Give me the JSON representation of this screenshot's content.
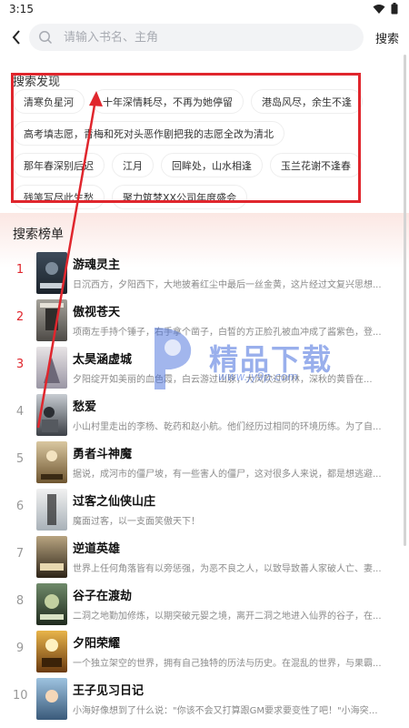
{
  "status": {
    "time": "3:15"
  },
  "search": {
    "placeholder": "请输入书名、主角",
    "button_label": "搜索"
  },
  "discover": {
    "title": "搜索发现",
    "tags": [
      "清寒负星河",
      "十年深情耗尽，不再为她停留",
      "港岛风尽，余生不逢",
      "高考填志愿，青梅和死对头恶作剧把我的志愿全改为清北",
      "那年春深别后迟",
      "江月",
      "回眸处，山水相逢",
      "玉兰花谢不逢春",
      "残笺写尽此生愁",
      "聚力筑梦XX公司年度盛会"
    ]
  },
  "ranking": {
    "title": "搜索榜单",
    "items": [
      {
        "rank": "1",
        "title": "游魂灵主",
        "desc": "日沉西方，夕阳西下，大地披着红尘中最后一丝金黄，这片经过文复兴思想...",
        "top": true
      },
      {
        "rank": "2",
        "title": "傲视苍天",
        "desc": "项南左手持个锤子，右手拿个凿子，白皙的方正脸孔被血冲成了酱紫色，登...",
        "top": true
      },
      {
        "rank": "3",
        "title": "太昊涵虚城",
        "desc": "夕阳绽开如美丽的血色霞，白云游过山脉，大风吹过树林，深秋的黄昏在...",
        "top": true
      },
      {
        "rank": "4",
        "title": "愁爱",
        "desc": "小山村里走出的李杨、乾药和赵小航。他们经历过相同的环境历练。为了自...",
        "top": false
      },
      {
        "rank": "5",
        "title": "勇者斗神魔",
        "desc": "据说，成河市的僵尸坡，有一些害人的僵尸，这对很多人来说，都是想逃避...",
        "top": false
      },
      {
        "rank": "6",
        "title": "过客之仙侠山庄",
        "desc": "魔面过客，以一支面笑傲天下！",
        "top": false
      },
      {
        "rank": "7",
        "title": "逆道英雄",
        "desc": "世界上任何角落皆有以旁惩强，为恶不良之人，以致导致善人家破人亡、妻...",
        "top": false
      },
      {
        "rank": "8",
        "title": "谷子在渡劫",
        "desc": "二洞之地勤加修炼，以期突破元婴之境，离开二洞之地进入仙界的谷子，在...",
        "top": false
      },
      {
        "rank": "9",
        "title": "夕阳荣耀",
        "desc": "一个独立架空的世界，拥有自己独特的历法与历史。在混乱的世界，与果霸...",
        "top": false
      },
      {
        "rank": "10",
        "title": "王子见习日记",
        "desc": "小海好像想到了什么说：\"你该不会又打算跟GM要求要变性了吧！\"小海突然...",
        "top": false
      }
    ]
  },
  "watermark": {
    "text": "精品下载",
    "url": "www.jy9p.com"
  },
  "colors": {
    "accent": "#e0262d",
    "search_bg": "#f2f3f5",
    "desc": "#8a8a8a",
    "watermark": "#466edc"
  }
}
